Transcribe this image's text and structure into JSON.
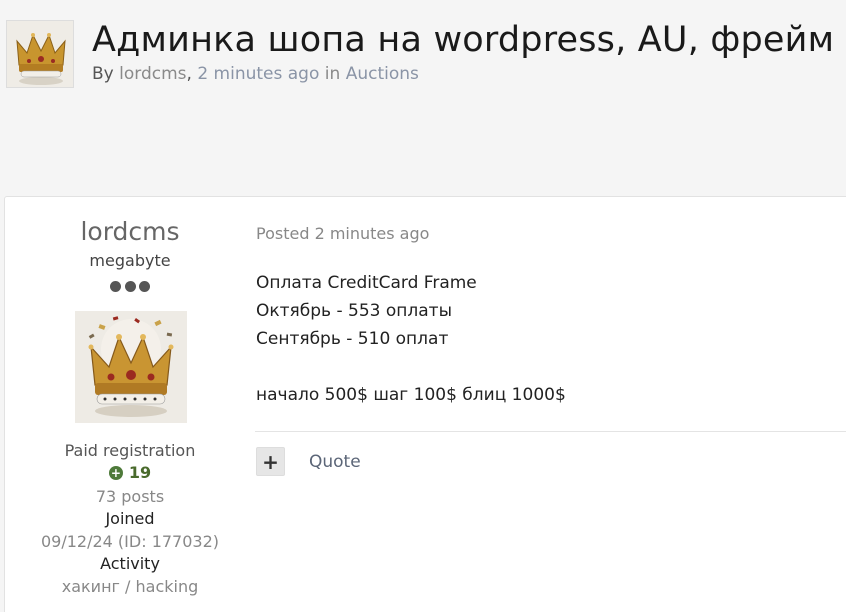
{
  "topic": {
    "title": "Админка шопа на wordpress, AU, фрейм",
    "by_prefix": "By ",
    "author": "lordcms",
    "separator": ", ",
    "time": "2 minutes ago",
    "in_word": " in ",
    "forum": "Auctions",
    "avatar_icon": "crown-image"
  },
  "author": {
    "name": "lordcms",
    "rank": "megabyte",
    "rank_pips": 3,
    "photo_icon": "crown-image",
    "group": "Paid registration",
    "reputation": "19",
    "reputation_icon": "plus-circle-icon",
    "posts": "73 posts",
    "joined_label": "Joined",
    "joined_value": "09/12/24 (ID: 177032)",
    "activity_label": "Activity",
    "activity_value": "хакинг / hacking"
  },
  "post": {
    "posted": "Posted 2 minutes ago",
    "lines": [
      "Оплата CreditCard Frame",
      "Октябрь - 553 оплаты",
      "Сентябрь - 510 оплат",
      "",
      "начало 500$ шаг 100$ блиц 1000$"
    ],
    "plus_label": "+",
    "quote_label": "Quote"
  },
  "colors": {
    "background": "#f5f5f5",
    "panel": "#ffffff",
    "link": "#8a94a6",
    "reputation": "#4a6b2d"
  }
}
